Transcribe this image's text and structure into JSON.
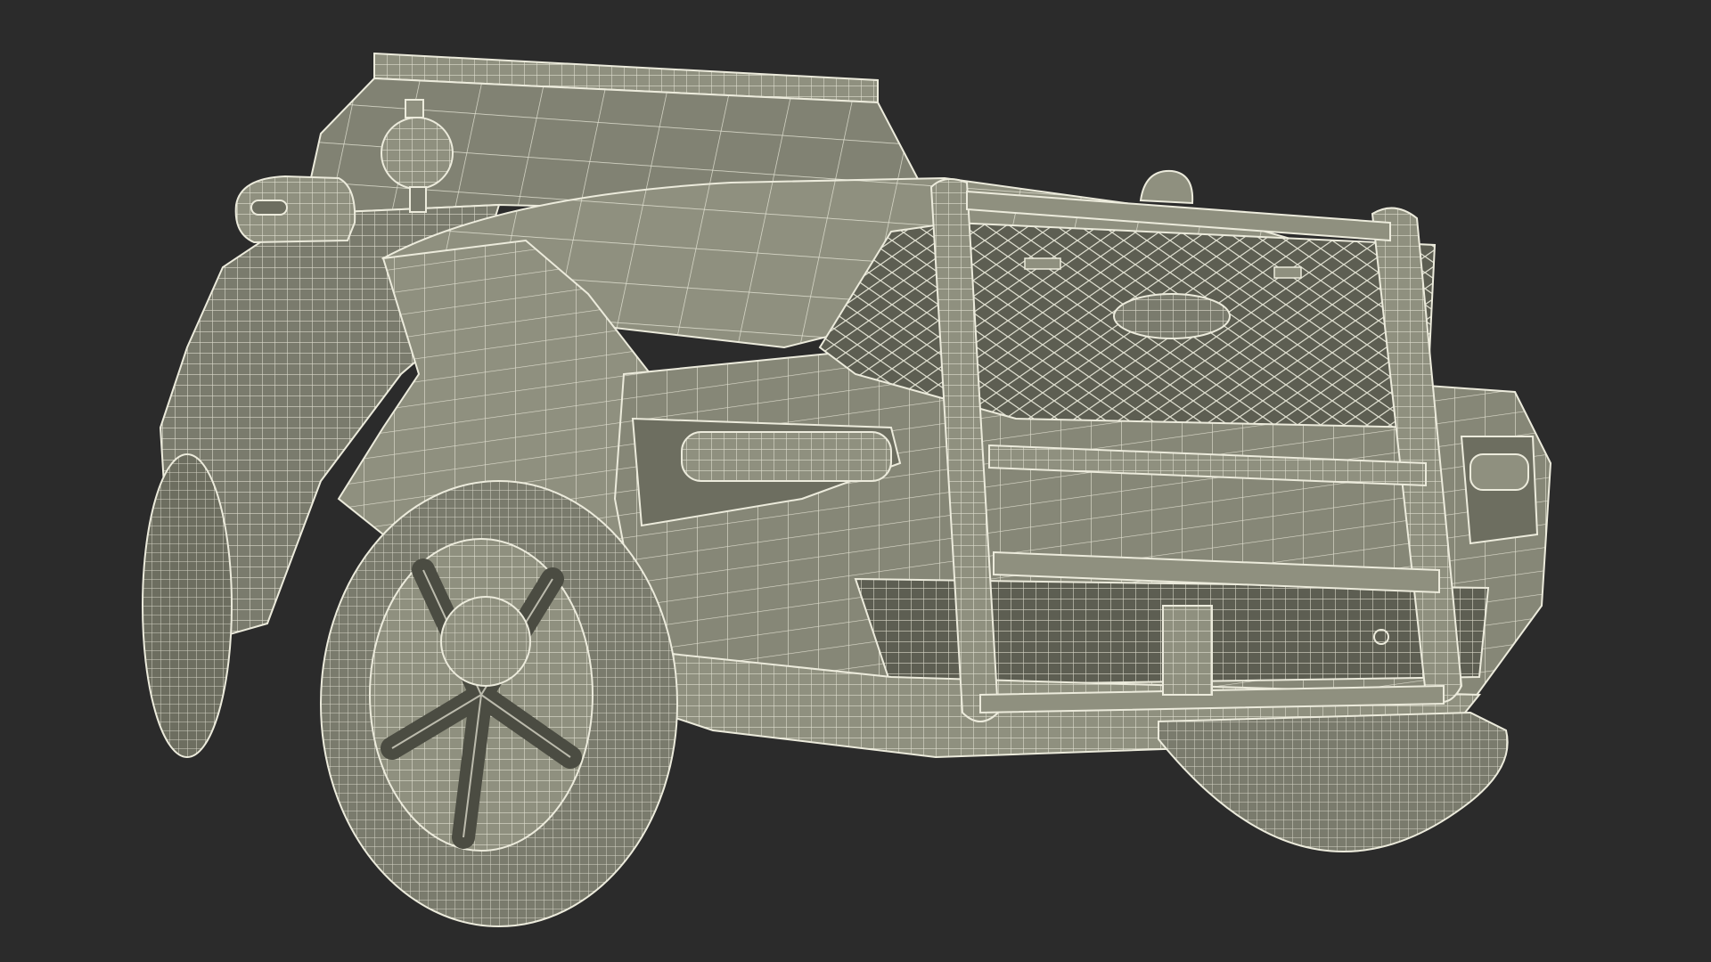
{
  "scene": {
    "subject_icon": "police-suv-wireframe-icon",
    "render_style": "wireframe",
    "colors": {
      "background": "#2b2b2b",
      "surface": "#8f907f",
      "surface_light": "#a3a493",
      "surface_dark": "#6d6e60",
      "shadow": "#4b4c42",
      "wire": "#ecebdc"
    }
  }
}
